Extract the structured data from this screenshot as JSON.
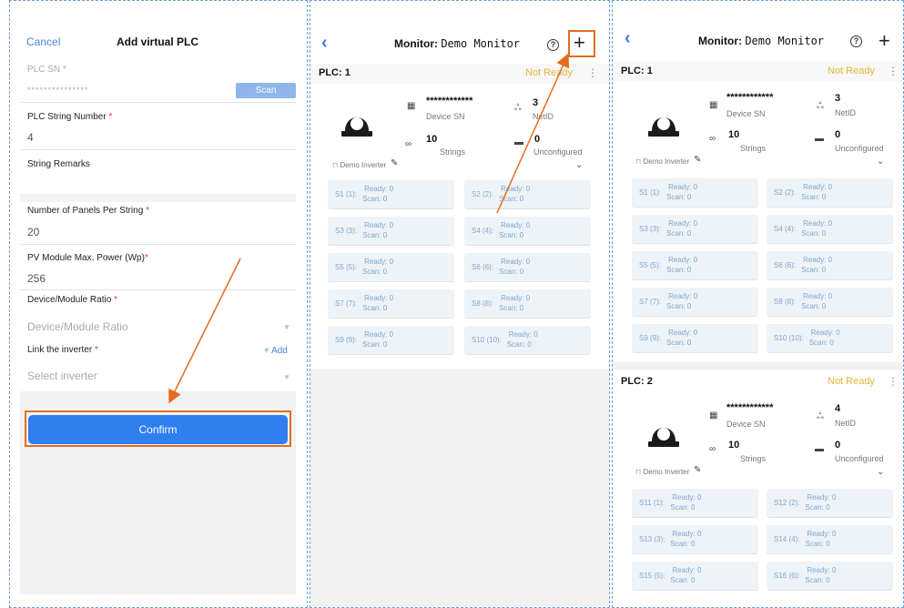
{
  "form": {
    "cancel": "Cancel",
    "title": "Add virtual PLC",
    "plc_sn_label": "PLC SN",
    "plc_sn_req": "*",
    "plc_sn_value": "***************",
    "scan": "Scan",
    "string_number_label": "PLC String Number",
    "string_number_value": "4",
    "remarks_label": "String Remarks",
    "panels_label": "Number of Panels Per String",
    "panels_value": "20",
    "power_label": "PV Module Max. Power (Wp)",
    "power_value": "256",
    "ratio_label": "Device/Module Ratio",
    "ratio_placeholder": "Device/Module Ratio",
    "inverter_label": "Link the inverter",
    "add": "Add",
    "inverter_placeholder": "Select inverter",
    "confirm": "Confirm",
    "req": "*"
  },
  "monitor": {
    "title_prefix": "Monitor:",
    "title_name": "Demo Monitor",
    "sn_mask": "************",
    "sn_label": "Device SN",
    "netid_label": "NetID",
    "strings_label": "Strings",
    "unconf_label": "Unconfigured",
    "inverter": "Demo Inverter",
    "status": "Not Ready"
  },
  "panel2": {
    "plc": {
      "name": "PLC: 1",
      "netid": "3",
      "strings": "10",
      "unconfigured": "0",
      "tiles": [
        {
          "id": "S1 (1):",
          "ready": "Ready: 0",
          "scan": "Scan: 0"
        },
        {
          "id": "S2 (2):",
          "ready": "Ready: 0",
          "scan": "Scan: 0"
        },
        {
          "id": "S3 (3):",
          "ready": "Ready: 0",
          "scan": "Scan: 0"
        },
        {
          "id": "S4 (4):",
          "ready": "Ready: 0",
          "scan": "Scan: 0"
        },
        {
          "id": "S5 (5):",
          "ready": "Ready: 0",
          "scan": "Scan: 0"
        },
        {
          "id": "S6 (6):",
          "ready": "Ready: 0",
          "scan": "Scan: 0"
        },
        {
          "id": "S7 (7):",
          "ready": "Ready: 0",
          "scan": "Scan: 0"
        },
        {
          "id": "S8 (8):",
          "ready": "Ready: 0",
          "scan": "Scan: 0"
        },
        {
          "id": "S9 (9):",
          "ready": "Ready: 0",
          "scan": "Scan: 0"
        },
        {
          "id": "S10 (10):",
          "ready": "Ready: 0",
          "scan": "Scan: 0"
        }
      ]
    }
  },
  "panel3": {
    "plc1": {
      "name": "PLC: 1",
      "netid": "3",
      "strings": "10",
      "unconfigured": "0",
      "tiles": [
        {
          "id": "S1 (1):",
          "ready": "Ready: 0",
          "scan": "Scan: 0"
        },
        {
          "id": "S2 (2):",
          "ready": "Ready: 0",
          "scan": "Scan: 0"
        },
        {
          "id": "S3 (3):",
          "ready": "Ready: 0",
          "scan": "Scan: 0"
        },
        {
          "id": "S4 (4):",
          "ready": "Ready: 0",
          "scan": "Scan: 0"
        },
        {
          "id": "S5 (5):",
          "ready": "Ready: 0",
          "scan": "Scan: 0"
        },
        {
          "id": "S6 (6):",
          "ready": "Ready: 0",
          "scan": "Scan: 0"
        },
        {
          "id": "S7 (7):",
          "ready": "Ready: 0",
          "scan": "Scan: 0"
        },
        {
          "id": "S8 (8):",
          "ready": "Ready: 0",
          "scan": "Scan: 0"
        },
        {
          "id": "S9 (9):",
          "ready": "Ready: 0",
          "scan": "Scan: 0"
        },
        {
          "id": "S10 (10):",
          "ready": "Ready: 0",
          "scan": "Scan: 0"
        }
      ]
    },
    "plc2": {
      "name": "PLC: 2",
      "netid": "4",
      "strings": "10",
      "unconfigured": "0",
      "tiles": [
        {
          "id": "S11 (1):",
          "ready": "Ready: 0",
          "scan": "Scan: 0"
        },
        {
          "id": "S12 (2):",
          "ready": "Ready: 0",
          "scan": "Scan: 0"
        },
        {
          "id": "S13 (3):",
          "ready": "Ready: 0",
          "scan": "Scan: 0"
        },
        {
          "id": "S14 (4):",
          "ready": "Ready: 0",
          "scan": "Scan: 0"
        },
        {
          "id": "S15 (5):",
          "ready": "Ready: 0",
          "scan": "Scan: 0"
        },
        {
          "id": "S16 (6):",
          "ready": "Ready: 0",
          "scan": "Scan: 0"
        }
      ]
    }
  },
  "colors": {
    "accent": "#2f7ff0",
    "highlight": "#e46d1d",
    "status": "#e5b53a",
    "tile_bg": "#eef3f8"
  }
}
